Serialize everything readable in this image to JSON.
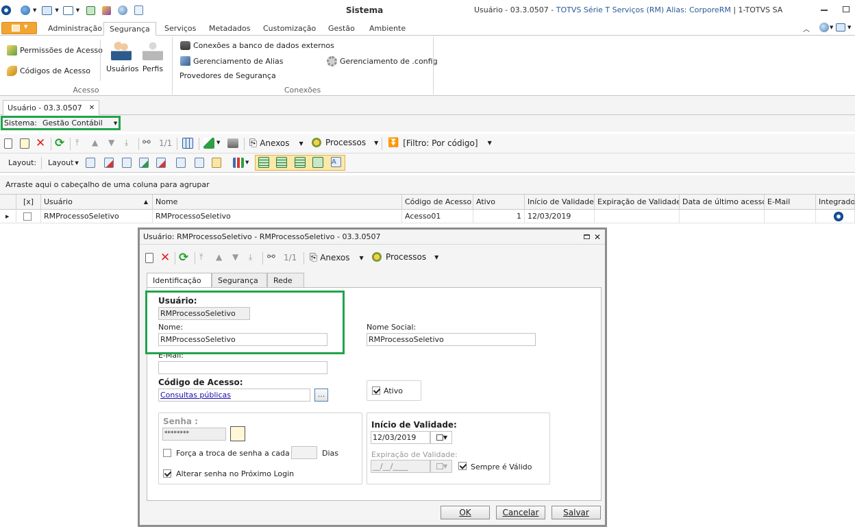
{
  "window": {
    "title": "Sistema",
    "user_info_prefix": "Usuário - 03.3.0507 - ",
    "user_info_blue": "TOTVS Série T Serviços (RM) Alias: CorporeRM",
    "user_info_suffix": " | 1-TOTVS SA"
  },
  "ribbon_tabs": [
    "Administração",
    "Segurança",
    "Serviços",
    "Metadados",
    "Customização",
    "Gestão",
    "Ambiente"
  ],
  "ribbon": {
    "acesso": {
      "permissoes": "Permissões de Acesso",
      "codigos": "Códigos de Acesso",
      "usuarios": "Usuários",
      "perfis": "Perfis",
      "group": "Acesso"
    },
    "conexoes": {
      "bd_externos": "Conexões a banco de dados externos",
      "alias": "Gerenciamento de Alias",
      "provedores": "Provedores de Segurança",
      "config": "Gerenciamento de .config",
      "group": "Conexões"
    }
  },
  "doc_tab": {
    "label": "Usuário - 03.3.0507",
    "close": "✕"
  },
  "sistema": {
    "label": "Sistema:",
    "value": "Gestão Contábil"
  },
  "toolbar1": {
    "counter": "1/1",
    "anexos": "Anexos",
    "processos": "Processos",
    "filtro": "[Filtro: Por código]"
  },
  "toolbar2": {
    "layout_label": "Layout:",
    "layout_btn": "Layout"
  },
  "grid": {
    "group_hint": "Arraste aqui o cabeçalho de uma coluna para agrupar",
    "columns": [
      "[x]",
      "Usuário",
      "Nome",
      "Código de Acesso",
      "Ativo",
      "Início de Validade",
      "Expiração de Validade",
      "Data de último acesso",
      "E-Mail",
      "Integrado"
    ],
    "row": {
      "usuario": "RMProcessoSeletivo",
      "nome": "RMProcessoSeletivo",
      "codigo": "Acesso01",
      "ativo": "1",
      "inicio": "12/03/2019"
    }
  },
  "dialog": {
    "title": "Usuário: RMProcessoSeletivo - RMProcessoSeletivo - 03.3.0507",
    "counter": "1/1",
    "anexos": "Anexos",
    "processos": "Processos",
    "tabs": [
      "Identificação",
      "Segurança",
      "Rede"
    ],
    "form": {
      "usuario_label": "Usuário:",
      "usuario_value": "RMProcessoSeletivo",
      "nome_label": "Nome:",
      "nome_value": "RMProcessoSeletivo",
      "nome_social_label": "Nome Social:",
      "nome_social_value": "RMProcessoSeletivo",
      "email_label": "E-Mail:",
      "codigo_label": "Código de Acesso:",
      "codigo_value": "Consultas públicas",
      "browse": "...",
      "ativo_label": "Ativo",
      "senha_label": "Senha :",
      "senha_value": "********",
      "forca_label": "Força a troca de senha a cada",
      "dias_label": "Dias",
      "alterar_label": "Alterar senha no Próximo Login",
      "inicio_label": "Início de Validade:",
      "inicio_value": "12/03/2019",
      "expiracao_label": "Expiração de Validade:",
      "expiracao_value": "__/__/____",
      "sempre_label": "Sempre é Válido"
    },
    "buttons": {
      "ok": "OK",
      "cancelar": "Cancelar",
      "salvar": "Salvar"
    }
  },
  "colors": {
    "highlight": "#21a34b",
    "file_tab": "#f2a531",
    "link": "#1a0dab"
  }
}
